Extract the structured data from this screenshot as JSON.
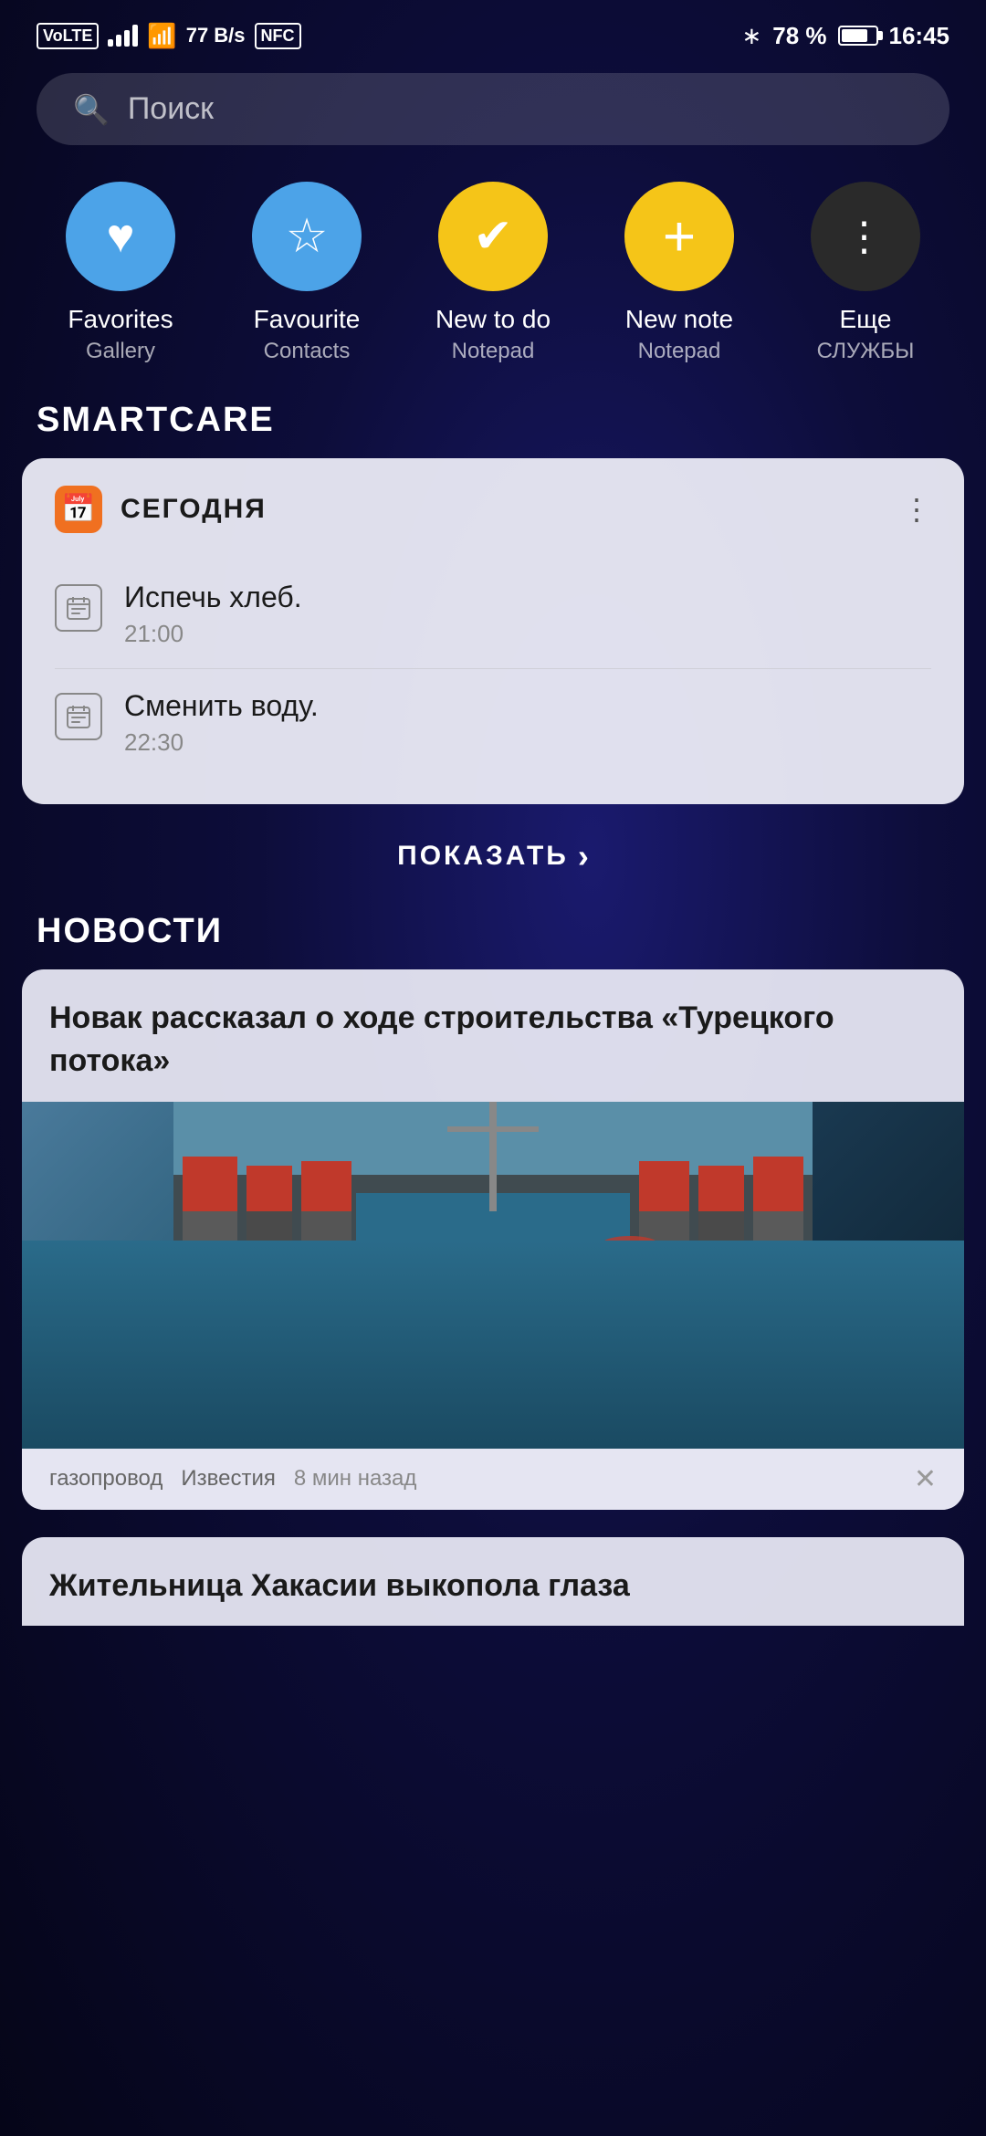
{
  "statusBar": {
    "left": {
      "volte": "VoLTE",
      "wifi_speed": "77 B/s",
      "nfc": "NFC"
    },
    "right": {
      "bluetooth": "78 %",
      "time": "16:45"
    }
  },
  "search": {
    "placeholder": "Поиск"
  },
  "shortcuts": [
    {
      "id": "favorites-gallery",
      "name": "Favorites",
      "sub": "Gallery",
      "icon": "♥",
      "color_class": "blue-solid"
    },
    {
      "id": "favourite-contacts",
      "name": "Favourite",
      "sub": "Contacts",
      "icon": "✩",
      "color_class": "blue-outline"
    },
    {
      "id": "new-todo-notepad",
      "name": "New to do",
      "sub": "Notepad",
      "icon": "✔",
      "color_class": "yellow"
    },
    {
      "id": "new-note-notepad",
      "name": "New note",
      "sub": "Notepad",
      "icon": "+",
      "color_class": "yellow2"
    },
    {
      "id": "more-services",
      "name": "Еще",
      "sub": "СЛУЖБЫ",
      "icon": "⋮",
      "color_class": "dark"
    }
  ],
  "smartcare": {
    "section_title": "SMARTCARE",
    "card": {
      "header_icon": "📅",
      "header_label": "СЕГОДНЯ",
      "menu_dots": "⋮",
      "tasks": [
        {
          "name": "Испечь хлеб.",
          "time": "21:00"
        },
        {
          "name": "Сменить воду.",
          "time": "22:30"
        }
      ]
    },
    "show_more": "ПОКАЗАТЬ",
    "show_more_arrow": "›"
  },
  "news": {
    "section_title": "НОВОСТИ",
    "articles": [
      {
        "title": "Новак рассказал о ходе строительства «Турецкого потока»",
        "tag": "газопровод",
        "source": "Известия",
        "time": "8 мин назад"
      },
      {
        "title": "Жительница Хакасии выкопола глаза",
        "tag": "",
        "source": "",
        "time": ""
      }
    ]
  }
}
